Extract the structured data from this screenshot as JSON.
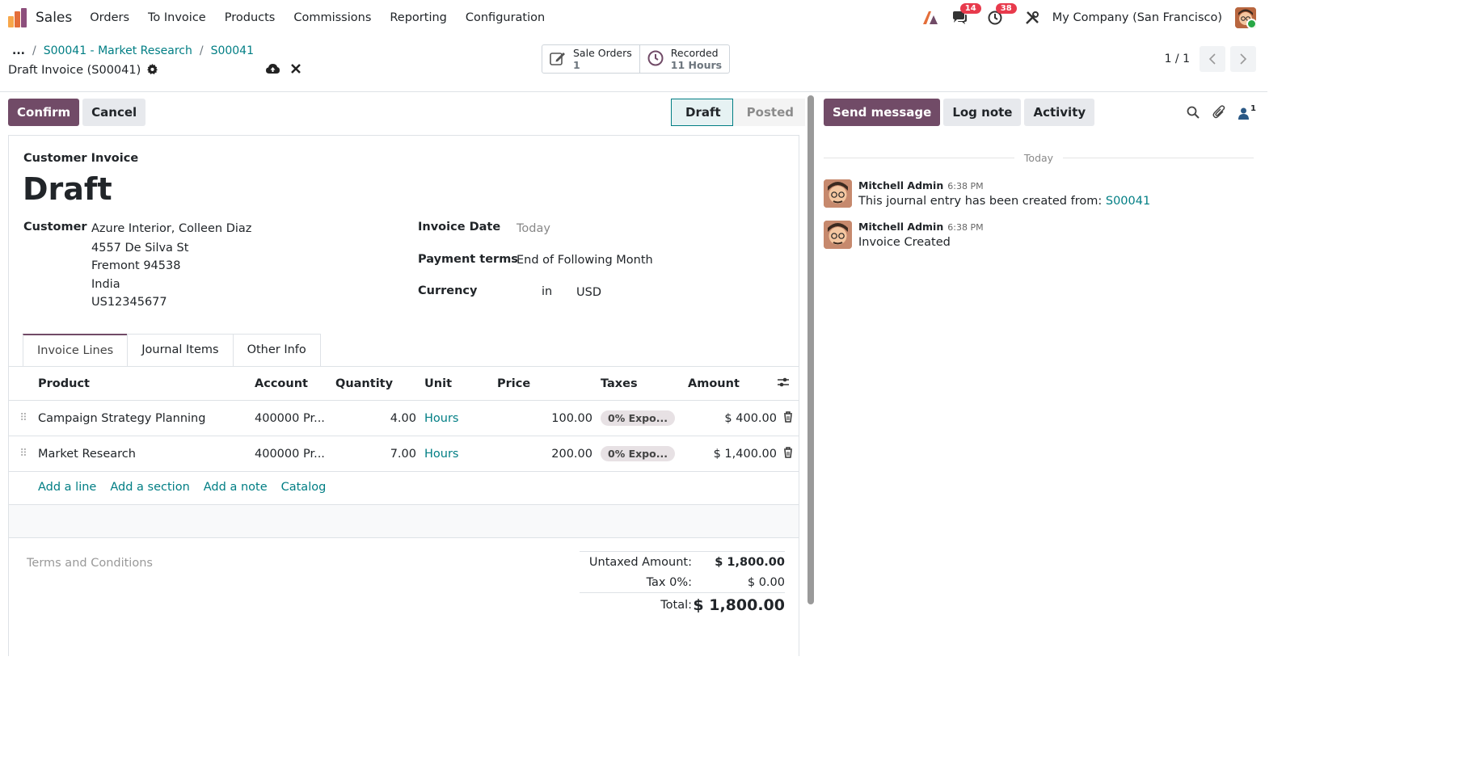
{
  "topbar": {
    "app_name": "Sales",
    "menu": [
      "Orders",
      "To Invoice",
      "Products",
      "Commissions",
      "Reporting",
      "Configuration"
    ],
    "messages_count": "14",
    "activities_count": "38",
    "company": "My Company (San Francisco)"
  },
  "breadcrumb": {
    "ellipsis": "...",
    "items": [
      "S00041 - Market Research",
      "S00041"
    ],
    "current": "Draft Invoice (S00041)"
  },
  "smart_buttons": [
    {
      "label": "Sale Orders",
      "value": "1"
    },
    {
      "label": "Recorded",
      "value": "11 Hours"
    }
  ],
  "pager": {
    "value": "1 / 1"
  },
  "actions": {
    "confirm": "Confirm",
    "cancel": "Cancel"
  },
  "statusbar": {
    "active": "Draft",
    "next": "Posted"
  },
  "form": {
    "subtitle": "Customer Invoice",
    "title": "Draft",
    "customer_label": "Customer",
    "customer_lines": [
      "Azure Interior, Colleen Diaz",
      "4557 De Silva St",
      "Fremont 94538",
      "India",
      "US12345677"
    ],
    "invoice_date_label": "Invoice Date",
    "invoice_date_placeholder": "Today",
    "payment_terms_label": "Payment terms",
    "payment_terms": "End of Following Month",
    "currency_label": "Currency",
    "currency_prefix": "in",
    "currency": "USD"
  },
  "tabs": [
    "Invoice Lines",
    "Journal Items",
    "Other Info"
  ],
  "table": {
    "headers": {
      "product": "Product",
      "account": "Account",
      "quantity": "Quantity",
      "unit": "Unit",
      "price": "Price",
      "taxes": "Taxes",
      "amount": "Amount"
    },
    "rows": [
      {
        "product": "Campaign Strategy Planning",
        "account": "400000 Pr...",
        "quantity": "4.00",
        "unit": "Hours",
        "price": "100.00",
        "taxes": "0% Expo...",
        "amount": "$ 400.00"
      },
      {
        "product": "Market Research",
        "account": "400000 Pr...",
        "quantity": "7.00",
        "unit": "Hours",
        "price": "200.00",
        "taxes": "0% Expo...",
        "amount": "$ 1,400.00"
      }
    ],
    "add_links": [
      "Add a line",
      "Add a section",
      "Add a note",
      "Catalog"
    ]
  },
  "terms_placeholder": "Terms and Conditions",
  "totals": {
    "untaxed_label": "Untaxed Amount:",
    "untaxed": "$ 1,800.00",
    "tax_label": "Tax 0%:",
    "tax": "$ 0.00",
    "total_label": "Total:",
    "total": "$ 1,800.00"
  },
  "chatter": {
    "send_message": "Send message",
    "log_note": "Log note",
    "activity": "Activity",
    "followers_count": "1",
    "date_sep": "Today",
    "messages": [
      {
        "author": "Mitchell Admin",
        "time": "6:38 PM",
        "body": "This journal entry has been created from: ",
        "link": "S00041"
      },
      {
        "author": "Mitchell Admin",
        "time": "6:38 PM",
        "body": "Invoice Created",
        "link": ""
      }
    ]
  },
  "colors": {
    "primary": "#714b67",
    "link": "#017e84",
    "badge": "#e83a4c"
  }
}
